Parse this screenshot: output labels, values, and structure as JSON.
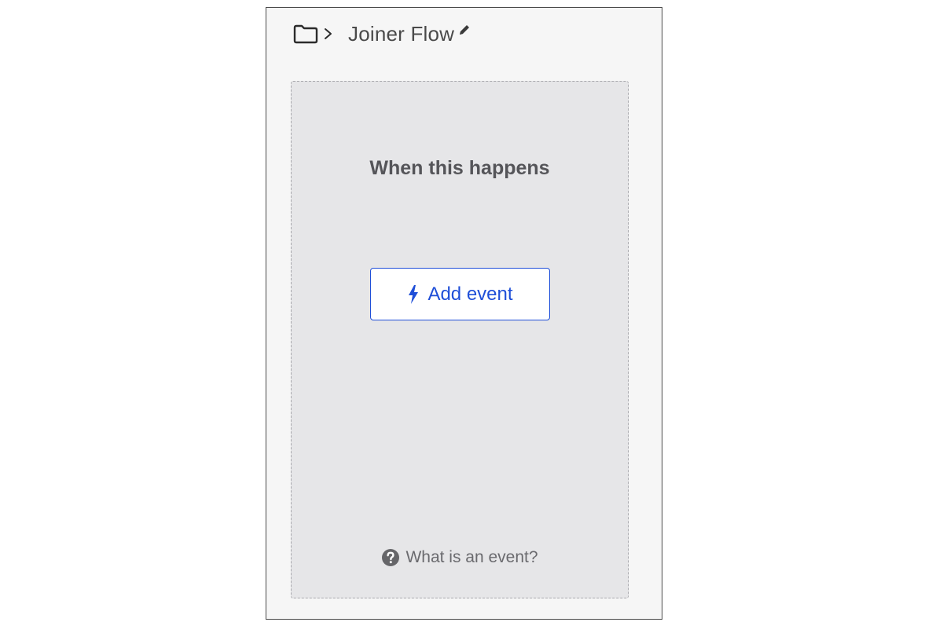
{
  "header": {
    "folder_icon": "folder-icon",
    "separator_icon": "chevron-right-icon",
    "title": "Joiner Flow",
    "edit_icon": "pencil-icon"
  },
  "trigger": {
    "heading": "When this happens",
    "add_button": {
      "icon": "lightning-bolt-icon",
      "label": "Add event"
    },
    "help_link": {
      "icon": "question-circle-icon",
      "label": "What is an event?"
    }
  },
  "colors": {
    "accent": "#1f4fd8",
    "panel_background": "#f6f6f6",
    "dropzone_background": "#e6e6e8",
    "text": "#4a4a4a"
  }
}
